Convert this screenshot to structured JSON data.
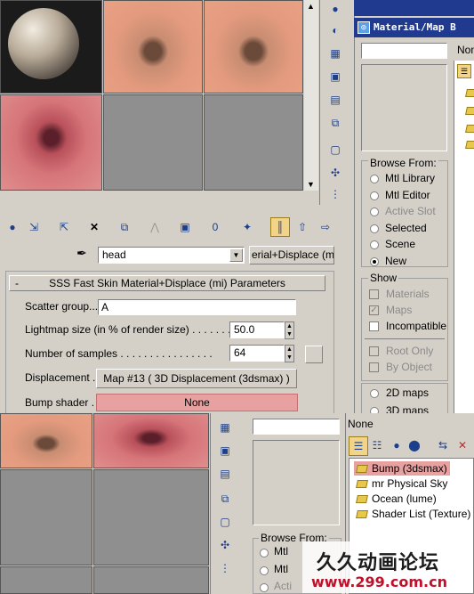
{
  "material_editor": {
    "title": "Material/Map B",
    "none_label": "None",
    "top_truncated_label": "None"
  },
  "name_field": {
    "value": "head",
    "type_button": "erial+Displace (mi)"
  },
  "rollout": {
    "title": "SSS Fast Skin Material+Displace (mi) Parameters",
    "collapse": "-"
  },
  "params": {
    "scatter_group": {
      "label": "Scatter group...",
      "value": "A"
    },
    "lightmap": {
      "label": "Lightmap size (in % of render size) . . . . . . . .",
      "value": "50.0"
    },
    "samples": {
      "label": "Number of samples . . . . . . . . . . . . . . . .",
      "value": "64"
    },
    "displacement": {
      "label": "Displacement . .",
      "button": "Map #13  ( 3D Displacement (3dsmax) )"
    },
    "bump": {
      "label": "Bump shader . .",
      "button": "None"
    }
  },
  "browse_from": {
    "title": "Browse From:",
    "options": [
      "Mtl Library",
      "Mtl Editor",
      "Active Slot",
      "Selected",
      "Scene",
      "New"
    ],
    "selected": "New"
  },
  "show": {
    "title": "Show",
    "checks": [
      {
        "label": "Materials",
        "checked": false,
        "enabled": false
      },
      {
        "label": "Maps",
        "checked": true,
        "enabled": false
      },
      {
        "label": "Incompatible",
        "checked": false,
        "enabled": true
      }
    ],
    "checks2": [
      {
        "label": "Root Only",
        "checked": false
      },
      {
        "label": "By Object",
        "checked": false
      }
    ],
    "radios": [
      "2D maps",
      "3D maps"
    ]
  },
  "browser2": {
    "none_label": "None",
    "items": [
      "Bump (3dsmax)",
      "mr Physical Sky",
      "Ocean (lume)",
      "Shader List (Texture)"
    ],
    "highlighted": "Bump (3dsmax)",
    "browse_from_title": "Browse From:",
    "browse_options": [
      "Mtl",
      "Mtl",
      "Acti"
    ]
  },
  "watermark": {
    "line1": "久久动画论坛",
    "line2": "www.299.com.cn"
  },
  "colors": {
    "selection_red": "#e8a1a1",
    "title_blue": "#1f3a8f",
    "watermark_red": "#c0102a"
  }
}
